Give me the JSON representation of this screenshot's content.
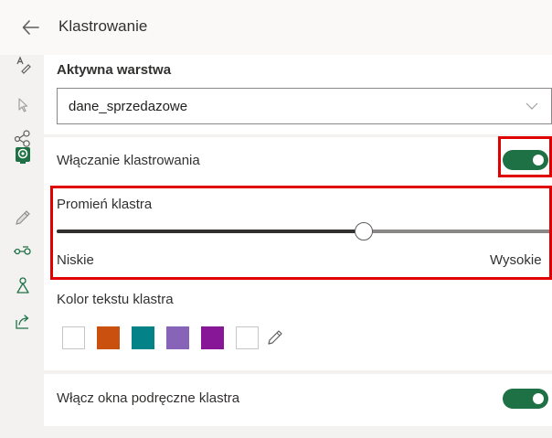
{
  "header": {
    "title": "Klastrowanie"
  },
  "sidebar": {
    "icons": [
      "text-style-icon",
      "pointer-icon",
      "cluster-icon",
      "map-pin-icon",
      "pencil-icon",
      "route-icon",
      "layer-add-icon",
      "share-icon"
    ]
  },
  "layer": {
    "label": "Aktywna warstwa",
    "selected": "dane_sprzedazowe"
  },
  "clustering": {
    "label": "Włączanie klastrowania",
    "enabled": true
  },
  "radius": {
    "label": "Promień klastra",
    "value": 0.62,
    "min_label": "Niskie",
    "max_label": "Wysokie"
  },
  "text_color": {
    "label": "Kolor tekstu klastra",
    "swatches": [
      "#ffffff",
      "#ca5010",
      "#038387",
      "#8764b8",
      "#881798",
      "#ffffff"
    ]
  },
  "popups": {
    "label": "Włącz okna podręczne klastra",
    "enabled": true
  },
  "colors": {
    "accent": "#1e7145",
    "highlight": "#e00000"
  }
}
